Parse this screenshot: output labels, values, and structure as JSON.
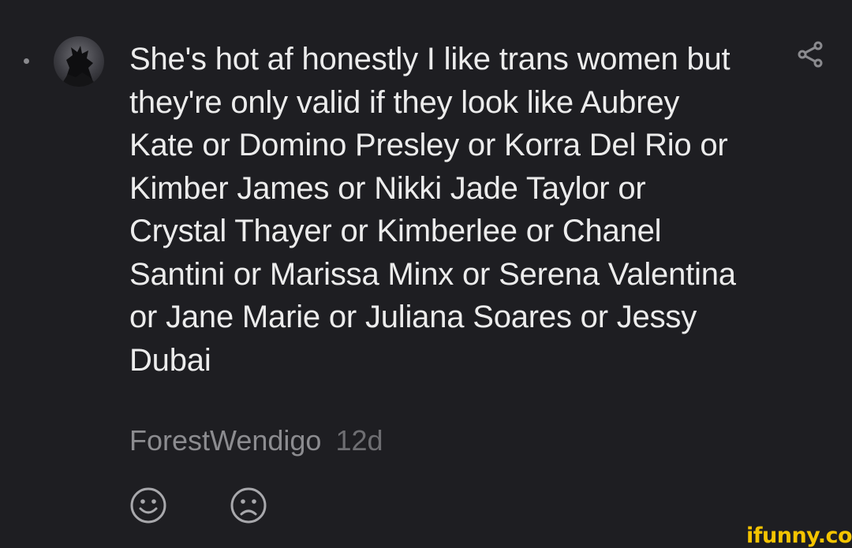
{
  "comment": {
    "text": "She's hot af honestly I like trans women but they're only valid if they look like Aubrey Kate or Domino Presley or Korra Del Rio or Kimber James or Nikki Jade Taylor or Crystal Thayer or Kimberlee or Chanel Santini or Marissa Minx or Serena Valentina or Jane Marie or Juliana Soares or Jessy Dubai",
    "username": "ForestWendigo",
    "age": "12d"
  },
  "icons": {
    "avatar": "user-avatar",
    "share": "share-icon",
    "upvote": "smile-icon",
    "downvote": "frown-icon"
  },
  "watermark": "ifunny.co",
  "colors": {
    "background": "#1e1e22",
    "text": "#ececec",
    "meta": "#8c8c90",
    "watermark": "#f5c400"
  }
}
